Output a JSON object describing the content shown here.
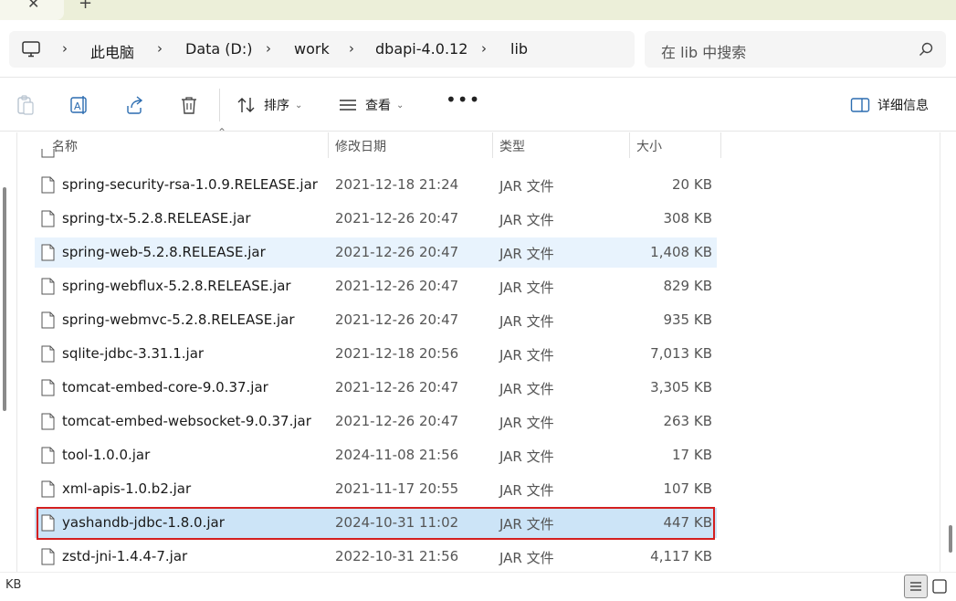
{
  "window": {
    "tab_close_glyph": "✕",
    "tab_new_glyph": "+"
  },
  "breadcrumb": {
    "items": [
      "此电脑",
      "Data (D:)",
      "work",
      "dbapi-4.0.12",
      "lib"
    ],
    "separator": "›"
  },
  "search": {
    "placeholder": "在 lib 中搜索"
  },
  "toolbar": {
    "sort_label": "排序",
    "view_label": "查看",
    "more_label": "•••",
    "details_label": "详细信息",
    "dropdown_glyph": "⌄"
  },
  "columns": {
    "name": "名称",
    "date": "修改日期",
    "type": "类型",
    "size": "大小",
    "sort_indicator": "⌃"
  },
  "files": [
    {
      "name": "spring-security-rsa-1.0.9.RELEASE.jar",
      "date": "2021-12-18 21:24",
      "type": "JAR 文件",
      "size": "20 KB"
    },
    {
      "name": "spring-tx-5.2.8.RELEASE.jar",
      "date": "2021-12-26 20:47",
      "type": "JAR 文件",
      "size": "308 KB"
    },
    {
      "name": "spring-web-5.2.8.RELEASE.jar",
      "date": "2021-12-26 20:47",
      "type": "JAR 文件",
      "size": "1,408 KB"
    },
    {
      "name": "spring-webflux-5.2.8.RELEASE.jar",
      "date": "2021-12-26 20:47",
      "type": "JAR 文件",
      "size": "829 KB"
    },
    {
      "name": "spring-webmvc-5.2.8.RELEASE.jar",
      "date": "2021-12-26 20:47",
      "type": "JAR 文件",
      "size": "935 KB"
    },
    {
      "name": "sqlite-jdbc-3.31.1.jar",
      "date": "2021-12-18 20:56",
      "type": "JAR 文件",
      "size": "7,013 KB"
    },
    {
      "name": "tomcat-embed-core-9.0.37.jar",
      "date": "2021-12-26 20:47",
      "type": "JAR 文件",
      "size": "3,305 KB"
    },
    {
      "name": "tomcat-embed-websocket-9.0.37.jar",
      "date": "2021-12-26 20:47",
      "type": "JAR 文件",
      "size": "263 KB"
    },
    {
      "name": "tool-1.0.0.jar",
      "date": "2024-11-08 21:56",
      "type": "JAR 文件",
      "size": "17 KB"
    },
    {
      "name": "xml-apis-1.0.b2.jar",
      "date": "2021-11-17 20:55",
      "type": "JAR 文件",
      "size": "107 KB"
    },
    {
      "name": "yashandb-jdbc-1.8.0.jar",
      "date": "2024-10-31 11:02",
      "type": "JAR 文件",
      "size": "447 KB"
    },
    {
      "name": "zstd-jni-1.4.4-7.jar",
      "date": "2022-10-31 21:56",
      "type": "JAR 文件",
      "size": "4,117 KB"
    }
  ],
  "hovered_file": "spring-web-5.2.8.RELEASE.jar",
  "selected_file": "yashandb-jdbc-1.8.0.jar",
  "status": {
    "text": "KB"
  },
  "colors": {
    "selected_bg": "#cce4f7",
    "hover_bg": "#e8f3fd",
    "highlight_border": "#d42020",
    "tabbar_bg": "#ecefd9"
  }
}
